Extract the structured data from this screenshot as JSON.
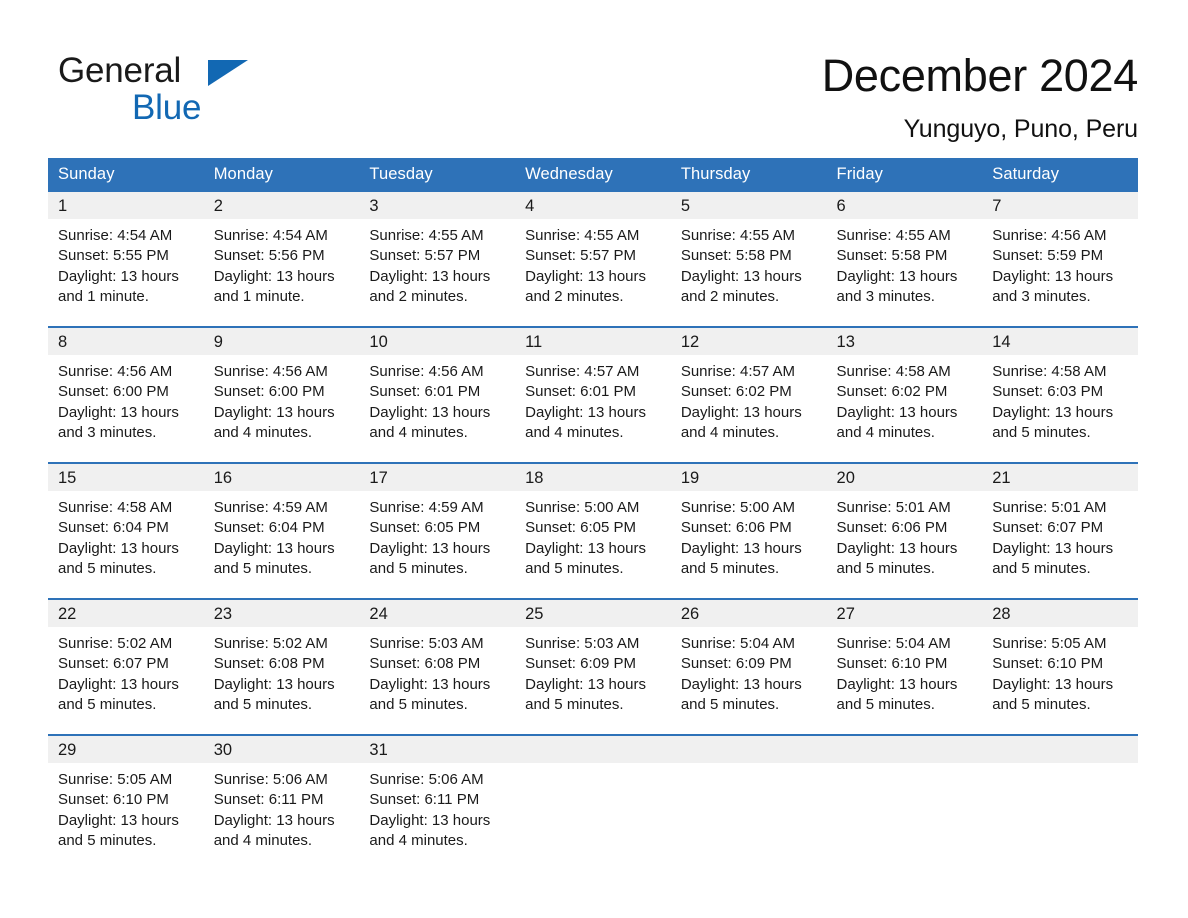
{
  "brand": {
    "line1": "General",
    "line2": "Blue",
    "triangle_color": "#1268b3",
    "text_color": "#1a1a1a"
  },
  "header": {
    "title": "December 2024",
    "subtitle": "Yunguyo, Puno, Peru"
  },
  "theme": {
    "header_bg": "#2e72b8",
    "header_text": "#ffffff",
    "daynum_band_bg": "#f0f0f0",
    "row_border": "#2e72b8",
    "body_text": "#1a1a1a",
    "page_bg": "#ffffff"
  },
  "weekday_headers": [
    "Sunday",
    "Monday",
    "Tuesday",
    "Wednesday",
    "Thursday",
    "Friday",
    "Saturday"
  ],
  "weeks": [
    [
      {
        "day": "1",
        "sunrise": "Sunrise: 4:54 AM",
        "sunset": "Sunset: 5:55 PM",
        "daylight_line1": "Daylight: 13 hours",
        "daylight_line2": "and 1 minute."
      },
      {
        "day": "2",
        "sunrise": "Sunrise: 4:54 AM",
        "sunset": "Sunset: 5:56 PM",
        "daylight_line1": "Daylight: 13 hours",
        "daylight_line2": "and 1 minute."
      },
      {
        "day": "3",
        "sunrise": "Sunrise: 4:55 AM",
        "sunset": "Sunset: 5:57 PM",
        "daylight_line1": "Daylight: 13 hours",
        "daylight_line2": "and 2 minutes."
      },
      {
        "day": "4",
        "sunrise": "Sunrise: 4:55 AM",
        "sunset": "Sunset: 5:57 PM",
        "daylight_line1": "Daylight: 13 hours",
        "daylight_line2": "and 2 minutes."
      },
      {
        "day": "5",
        "sunrise": "Sunrise: 4:55 AM",
        "sunset": "Sunset: 5:58 PM",
        "daylight_line1": "Daylight: 13 hours",
        "daylight_line2": "and 2 minutes."
      },
      {
        "day": "6",
        "sunrise": "Sunrise: 4:55 AM",
        "sunset": "Sunset: 5:58 PM",
        "daylight_line1": "Daylight: 13 hours",
        "daylight_line2": "and 3 minutes."
      },
      {
        "day": "7",
        "sunrise": "Sunrise: 4:56 AM",
        "sunset": "Sunset: 5:59 PM",
        "daylight_line1": "Daylight: 13 hours",
        "daylight_line2": "and 3 minutes."
      }
    ],
    [
      {
        "day": "8",
        "sunrise": "Sunrise: 4:56 AM",
        "sunset": "Sunset: 6:00 PM",
        "daylight_line1": "Daylight: 13 hours",
        "daylight_line2": "and 3 minutes."
      },
      {
        "day": "9",
        "sunrise": "Sunrise: 4:56 AM",
        "sunset": "Sunset: 6:00 PM",
        "daylight_line1": "Daylight: 13 hours",
        "daylight_line2": "and 4 minutes."
      },
      {
        "day": "10",
        "sunrise": "Sunrise: 4:56 AM",
        "sunset": "Sunset: 6:01 PM",
        "daylight_line1": "Daylight: 13 hours",
        "daylight_line2": "and 4 minutes."
      },
      {
        "day": "11",
        "sunrise": "Sunrise: 4:57 AM",
        "sunset": "Sunset: 6:01 PM",
        "daylight_line1": "Daylight: 13 hours",
        "daylight_line2": "and 4 minutes."
      },
      {
        "day": "12",
        "sunrise": "Sunrise: 4:57 AM",
        "sunset": "Sunset: 6:02 PM",
        "daylight_line1": "Daylight: 13 hours",
        "daylight_line2": "and 4 minutes."
      },
      {
        "day": "13",
        "sunrise": "Sunrise: 4:58 AM",
        "sunset": "Sunset: 6:02 PM",
        "daylight_line1": "Daylight: 13 hours",
        "daylight_line2": "and 4 minutes."
      },
      {
        "day": "14",
        "sunrise": "Sunrise: 4:58 AM",
        "sunset": "Sunset: 6:03 PM",
        "daylight_line1": "Daylight: 13 hours",
        "daylight_line2": "and 5 minutes."
      }
    ],
    [
      {
        "day": "15",
        "sunrise": "Sunrise: 4:58 AM",
        "sunset": "Sunset: 6:04 PM",
        "daylight_line1": "Daylight: 13 hours",
        "daylight_line2": "and 5 minutes."
      },
      {
        "day": "16",
        "sunrise": "Sunrise: 4:59 AM",
        "sunset": "Sunset: 6:04 PM",
        "daylight_line1": "Daylight: 13 hours",
        "daylight_line2": "and 5 minutes."
      },
      {
        "day": "17",
        "sunrise": "Sunrise: 4:59 AM",
        "sunset": "Sunset: 6:05 PM",
        "daylight_line1": "Daylight: 13 hours",
        "daylight_line2": "and 5 minutes."
      },
      {
        "day": "18",
        "sunrise": "Sunrise: 5:00 AM",
        "sunset": "Sunset: 6:05 PM",
        "daylight_line1": "Daylight: 13 hours",
        "daylight_line2": "and 5 minutes."
      },
      {
        "day": "19",
        "sunrise": "Sunrise: 5:00 AM",
        "sunset": "Sunset: 6:06 PM",
        "daylight_line1": "Daylight: 13 hours",
        "daylight_line2": "and 5 minutes."
      },
      {
        "day": "20",
        "sunrise": "Sunrise: 5:01 AM",
        "sunset": "Sunset: 6:06 PM",
        "daylight_line1": "Daylight: 13 hours",
        "daylight_line2": "and 5 minutes."
      },
      {
        "day": "21",
        "sunrise": "Sunrise: 5:01 AM",
        "sunset": "Sunset: 6:07 PM",
        "daylight_line1": "Daylight: 13 hours",
        "daylight_line2": "and 5 minutes."
      }
    ],
    [
      {
        "day": "22",
        "sunrise": "Sunrise: 5:02 AM",
        "sunset": "Sunset: 6:07 PM",
        "daylight_line1": "Daylight: 13 hours",
        "daylight_line2": "and 5 minutes."
      },
      {
        "day": "23",
        "sunrise": "Sunrise: 5:02 AM",
        "sunset": "Sunset: 6:08 PM",
        "daylight_line1": "Daylight: 13 hours",
        "daylight_line2": "and 5 minutes."
      },
      {
        "day": "24",
        "sunrise": "Sunrise: 5:03 AM",
        "sunset": "Sunset: 6:08 PM",
        "daylight_line1": "Daylight: 13 hours",
        "daylight_line2": "and 5 minutes."
      },
      {
        "day": "25",
        "sunrise": "Sunrise: 5:03 AM",
        "sunset": "Sunset: 6:09 PM",
        "daylight_line1": "Daylight: 13 hours",
        "daylight_line2": "and 5 minutes."
      },
      {
        "day": "26",
        "sunrise": "Sunrise: 5:04 AM",
        "sunset": "Sunset: 6:09 PM",
        "daylight_line1": "Daylight: 13 hours",
        "daylight_line2": "and 5 minutes."
      },
      {
        "day": "27",
        "sunrise": "Sunrise: 5:04 AM",
        "sunset": "Sunset: 6:10 PM",
        "daylight_line1": "Daylight: 13 hours",
        "daylight_line2": "and 5 minutes."
      },
      {
        "day": "28",
        "sunrise": "Sunrise: 5:05 AM",
        "sunset": "Sunset: 6:10 PM",
        "daylight_line1": "Daylight: 13 hours",
        "daylight_line2": "and 5 minutes."
      }
    ],
    [
      {
        "day": "29",
        "sunrise": "Sunrise: 5:05 AM",
        "sunset": "Sunset: 6:10 PM",
        "daylight_line1": "Daylight: 13 hours",
        "daylight_line2": "and 5 minutes."
      },
      {
        "day": "30",
        "sunrise": "Sunrise: 5:06 AM",
        "sunset": "Sunset: 6:11 PM",
        "daylight_line1": "Daylight: 13 hours",
        "daylight_line2": "and 4 minutes."
      },
      {
        "day": "31",
        "sunrise": "Sunrise: 5:06 AM",
        "sunset": "Sunset: 6:11 PM",
        "daylight_line1": "Daylight: 13 hours",
        "daylight_line2": "and 4 minutes."
      },
      {
        "day": "",
        "sunrise": "",
        "sunset": "",
        "daylight_line1": "",
        "daylight_line2": ""
      },
      {
        "day": "",
        "sunrise": "",
        "sunset": "",
        "daylight_line1": "",
        "daylight_line2": ""
      },
      {
        "day": "",
        "sunrise": "",
        "sunset": "",
        "daylight_line1": "",
        "daylight_line2": ""
      },
      {
        "day": "",
        "sunrise": "",
        "sunset": "",
        "daylight_line1": "",
        "daylight_line2": ""
      }
    ]
  ]
}
